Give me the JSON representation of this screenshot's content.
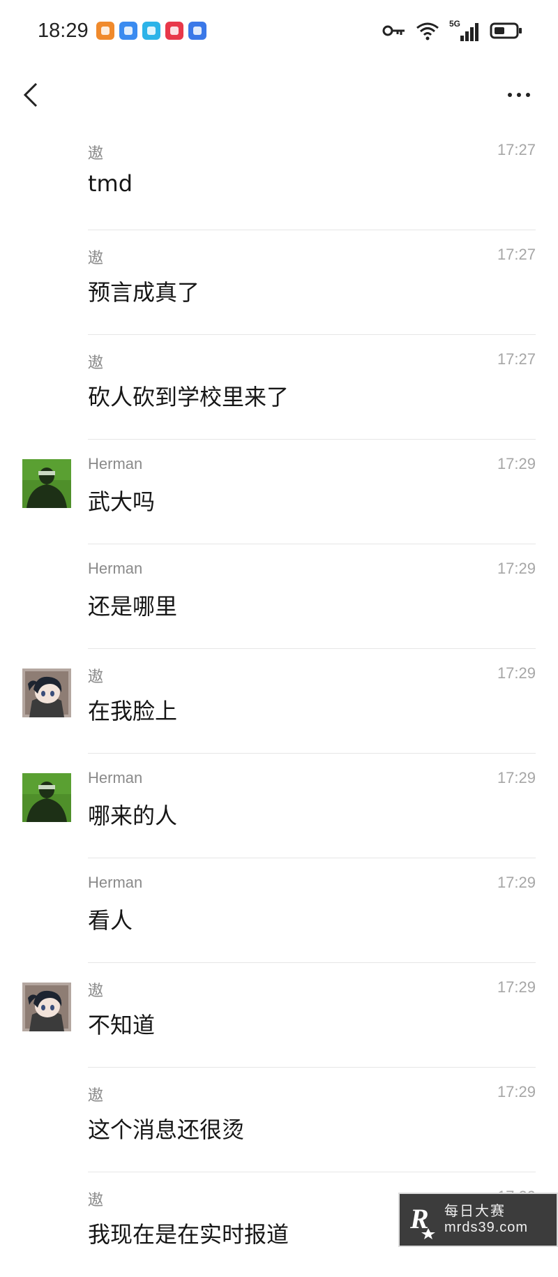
{
  "status_bar": {
    "time": "18:29",
    "network": "5G",
    "notification_icons": [
      {
        "name": "app-icon-orange",
        "color": "#f08a2c"
      },
      {
        "name": "app-icon-blue",
        "color": "#3a8bf0"
      },
      {
        "name": "app-icon-cyan",
        "color": "#2cb3e8"
      },
      {
        "name": "app-icon-red",
        "color": "#e8384a"
      },
      {
        "name": "app-icon-blue-2",
        "color": "#3a78e8"
      }
    ]
  },
  "nav": {
    "back_icon": "chevron-left-icon",
    "more_icon": "more-icon"
  },
  "messages": [
    {
      "sender": "遨",
      "time": "17:27",
      "text": "tmd",
      "avatar": "none"
    },
    {
      "sender": "遨",
      "time": "17:27",
      "text": "预言成真了",
      "avatar": "none"
    },
    {
      "sender": "遨",
      "time": "17:27",
      "text": "砍人砍到学校里来了",
      "avatar": "none"
    },
    {
      "sender": "Herman",
      "time": "17:29",
      "text": "武大吗",
      "avatar": "herman"
    },
    {
      "sender": "Herman",
      "time": "17:29",
      "text": "还是哪里",
      "avatar": "none"
    },
    {
      "sender": "遨",
      "time": "17:29",
      "text": "在我脸上",
      "avatar": "ao"
    },
    {
      "sender": "Herman",
      "time": "17:29",
      "text": "哪来的人",
      "avatar": "herman"
    },
    {
      "sender": "Herman",
      "time": "17:29",
      "text": "看人",
      "avatar": "none"
    },
    {
      "sender": "遨",
      "time": "17:29",
      "text": "不知道",
      "avatar": "ao"
    },
    {
      "sender": "遨",
      "time": "17:29",
      "text": "这个消息还很烫",
      "avatar": "none"
    },
    {
      "sender": "遨",
      "time": "17:29",
      "text": "我现在是在实时报道",
      "avatar": "none"
    }
  ],
  "watermark": {
    "title": "每日大赛",
    "url": "mrds39.com"
  }
}
